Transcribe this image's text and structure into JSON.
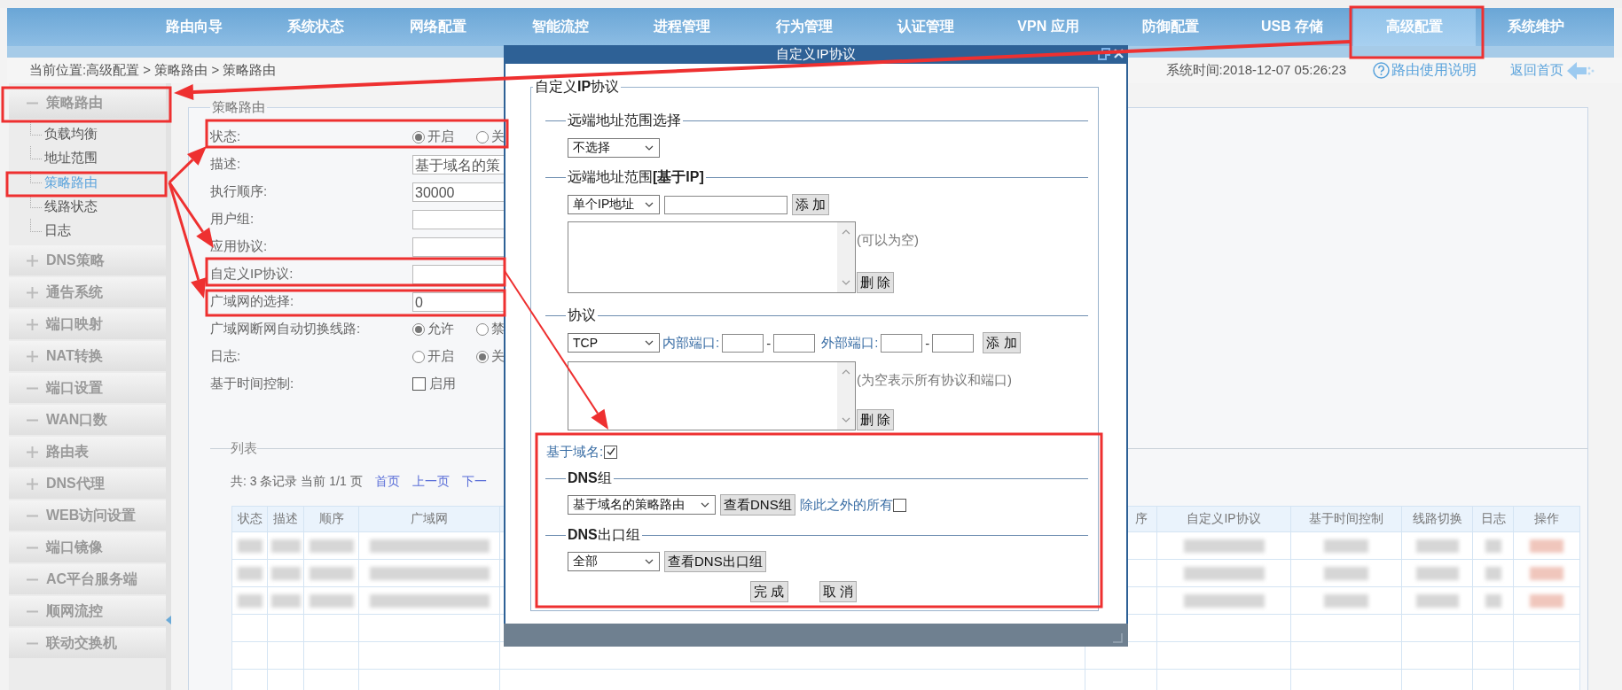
{
  "nav": {
    "items": [
      {
        "label": "路由向导",
        "selected": false
      },
      {
        "label": "系统状态",
        "selected": false
      },
      {
        "label": "网络配置",
        "selected": false
      },
      {
        "label": "智能流控",
        "selected": false
      },
      {
        "label": "进程管理",
        "selected": false
      },
      {
        "label": "行为管理",
        "selected": false
      },
      {
        "label": "认证管理",
        "selected": false
      },
      {
        "label": "VPN 应用",
        "selected": false
      },
      {
        "label": "防御配置",
        "selected": false
      },
      {
        "label": "USB 存储",
        "selected": false
      },
      {
        "label": "高级配置",
        "selected": true
      },
      {
        "label": "系统维护",
        "selected": false
      }
    ]
  },
  "breadcrumb": "当前位置:高级配置 > 策略路由 > 策略路由",
  "system_time": "系统时间:2018-12-07 05:26:23",
  "help_link": "路由使用说明",
  "home_link": "返回首页",
  "sidebar": {
    "header": {
      "label": "策略路由",
      "kind": "minus"
    },
    "items": [
      {
        "label": "负载均衡",
        "selected": false
      },
      {
        "label": "地址范围",
        "selected": false
      },
      {
        "label": "策略路由",
        "selected": true
      },
      {
        "label": "线路状态",
        "selected": false
      },
      {
        "label": "日志",
        "selected": false
      }
    ],
    "sections": [
      {
        "label": "DNS策略",
        "kind": "plus"
      },
      {
        "label": "通告系统",
        "kind": "plus"
      },
      {
        "label": "端口映射",
        "kind": "plus"
      },
      {
        "label": "NAT转换",
        "kind": "plus"
      },
      {
        "label": "端口设置",
        "kind": "minus"
      },
      {
        "label": "WAN口数",
        "kind": "minus"
      },
      {
        "label": "路由表",
        "kind": "plus"
      },
      {
        "label": "DNS代理",
        "kind": "plus"
      },
      {
        "label": "WEB访问设置",
        "kind": "minus"
      },
      {
        "label": "端口镜像",
        "kind": "minus"
      },
      {
        "label": "AC平台服务端",
        "kind": "minus"
      },
      {
        "label": "顺网流控",
        "kind": "minus"
      },
      {
        "label": "联动交换机",
        "kind": "minus"
      }
    ]
  },
  "form": {
    "legend": "策略路由",
    "rows": [
      {
        "label": "状态:",
        "kind": "radio",
        "options": [
          {
            "label": "开启",
            "selected": true
          },
          {
            "label": "关",
            "selected": false
          }
        ]
      },
      {
        "label": "描述:",
        "kind": "input",
        "value": "基于域名的策"
      },
      {
        "label": "执行顺序:",
        "kind": "input",
        "value": "30000"
      },
      {
        "label": "用户组:",
        "kind": "input"
      },
      {
        "label": "应用协议:",
        "kind": "input"
      },
      {
        "label": "自定义IP协议:",
        "kind": "input"
      },
      {
        "label": "广域网的选择:",
        "kind": "input",
        "value": "0"
      },
      {
        "label": "广域网断网自动切换线路:",
        "kind": "radio",
        "options": [
          {
            "label": "允许",
            "selected": true
          },
          {
            "label": "禁",
            "selected": false
          }
        ]
      },
      {
        "label": "日志:",
        "kind": "radio",
        "options": [
          {
            "label": "开启",
            "selected": false
          },
          {
            "label": "关",
            "selected": true
          }
        ]
      },
      {
        "label": "基于时间控制:",
        "kind": "checkbox",
        "option": "启用",
        "checked": false
      }
    ]
  },
  "list": {
    "legend": "列表",
    "summary": "共: 3 条记录 当前 1/1 页",
    "links": [
      "首页",
      "上一页",
      "下一"
    ],
    "table": {
      "columns": [
        "状态",
        "描述",
        "顺序",
        "广域网",
        "序",
        "自定义IP协议",
        "基于时间控制",
        "线路切换",
        "日志",
        "操作"
      ],
      "rows": [
        {
          "kind": "redacted"
        },
        {
          "kind": "redacted"
        },
        {
          "kind": "redacted"
        }
      ]
    }
  },
  "dialog": {
    "title": "自定义IP协议",
    "legend": "自定义**IP**协议",
    "remote_range_select": {
      "legend": "远端地址范围选择",
      "select": "不选择"
    },
    "remote_range_ip": {
      "legend": "远端地址范围**[基于IP]**",
      "select": "单个IP地址",
      "add_button": "添 加",
      "hint": "(可以为空)",
      "delete_button": "删 除"
    },
    "protocol": {
      "legend": "协议",
      "select": "TCP",
      "internal_port_label": "内部端口:",
      "separator_1": "-",
      "external_port_label": "外部端口:",
      "separator_2": "-",
      "add_button": "添 加",
      "hint": "(为空表示所有协议和端口)",
      "delete_button": "删 除"
    },
    "domain_based": {
      "label": "基于域名:",
      "checked": true
    },
    "dns_group": {
      "legend": "**DNS**组",
      "select": "基于域名的策略路由",
      "view_button": "查看DNS组",
      "except_label": "除此之外的所有",
      "except_checked": false
    },
    "dns_exit_group": {
      "legend": "**DNS**出口组",
      "select": "全部",
      "view_button": "查看DNS出口组"
    },
    "buttons": [
      "完 成",
      "取 消"
    ]
  }
}
